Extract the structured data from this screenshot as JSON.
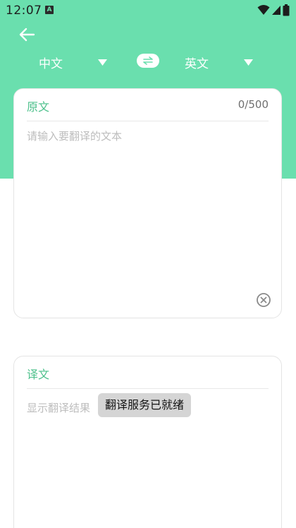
{
  "status_bar": {
    "time": "12:07",
    "notification_icon": "a-icon",
    "right_icons": [
      "wifi-icon",
      "signal-icon",
      "battery-icon"
    ]
  },
  "toolbar": {
    "back_icon": "arrow-left-icon",
    "source_language": "中文",
    "target_language": "英文",
    "swap_icon": "swap-arrows-icon",
    "dropdown_icon": "triangle-down-icon"
  },
  "source_card": {
    "title": "原文",
    "char_count": "0/500",
    "placeholder": "请输入要翻译的文本",
    "clear_icon": "clear-circle-icon"
  },
  "target_card": {
    "title": "译文",
    "result_placeholder": "显示翻译结果"
  },
  "toast": {
    "message": "翻译服务已就绪"
  },
  "colors": {
    "header_green": "#6adfae",
    "accent_green": "#4cc08b"
  }
}
